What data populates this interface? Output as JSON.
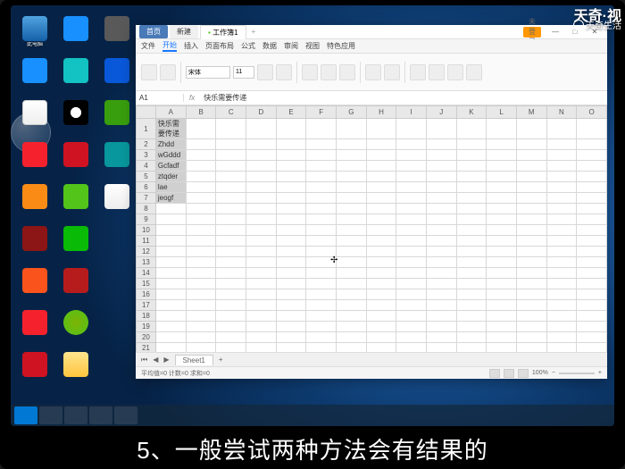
{
  "watermarks": {
    "top_right": "天奇·视",
    "top_right2": "天奇生活"
  },
  "caption": "5、一般尝试两种方法会有结果的",
  "desktop_icons": {
    "col0": [
      "此电脑",
      "",
      "",
      "",
      "",
      "",
      "",
      "",
      "",
      "",
      ""
    ],
    "col1": [
      "",
      "",
      "",
      "",
      "",
      "",
      "",
      "",
      "",
      ""
    ],
    "col2": [
      "",
      "",
      "",
      "",
      "",
      "",
      "",
      "",
      ""
    ]
  },
  "excel": {
    "tabs": {
      "home": "首页",
      "doc": "新建",
      "active": "工作簿1"
    },
    "login": "未登录",
    "menu": [
      "文件",
      "开始",
      "插入",
      "页面布局",
      "公式",
      "数据",
      "审阅",
      "视图",
      "特色应用"
    ],
    "font": "宋体",
    "fontsize": "11",
    "cellref": "A1",
    "fx": "fx",
    "formula_text": "快乐需要传递",
    "columns": [
      "A",
      "B",
      "C",
      "D",
      "E",
      "F",
      "G",
      "H",
      "I",
      "J",
      "K",
      "L",
      "M",
      "N",
      "O"
    ],
    "rows_count": 30,
    "data": {
      "r1": "快乐需要传递",
      "r2": "Zhdd",
      "r3": "wGddd",
      "r4": "Gcfadf",
      "r5": "ztqder",
      "r6": "lae",
      "r7": "jeogf"
    },
    "sheet": "Sheet1",
    "status_left": "平均值=0  计数=0  求和=0",
    "zoom": "100%"
  }
}
